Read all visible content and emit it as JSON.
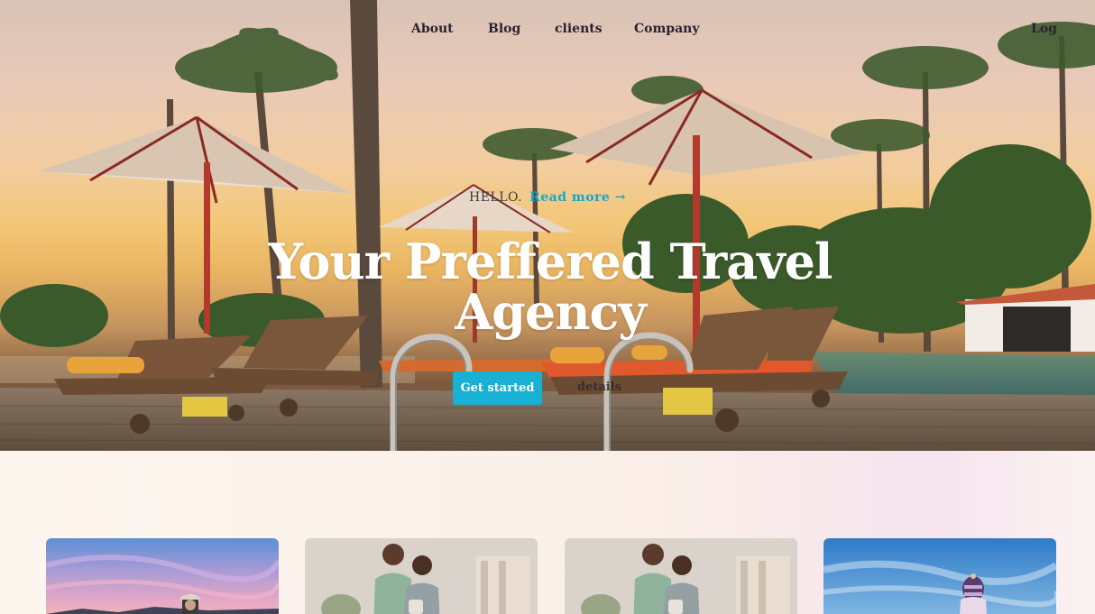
{
  "nav": {
    "items": [
      {
        "label": "About"
      },
      {
        "label": "Blog"
      },
      {
        "label": "clients"
      },
      {
        "label": "Company"
      }
    ],
    "login_label": "Log"
  },
  "hero": {
    "hello": "HELLO.",
    "read_more": "Read more →",
    "title": "Your Preffered Travel Agency",
    "cta_primary": "Get started",
    "cta_secondary": "details"
  },
  "cards": [
    {
      "image": "sunset-beach-traveler"
    },
    {
      "image": "couple-at-home"
    },
    {
      "image": "couple-at-home"
    },
    {
      "image": "blue-sky-traveler"
    }
  ],
  "colors": {
    "accent": "#19b1d3",
    "link": "#1aa3c7",
    "nav_text": "#2b2230",
    "hero_title": "#ffffff"
  }
}
